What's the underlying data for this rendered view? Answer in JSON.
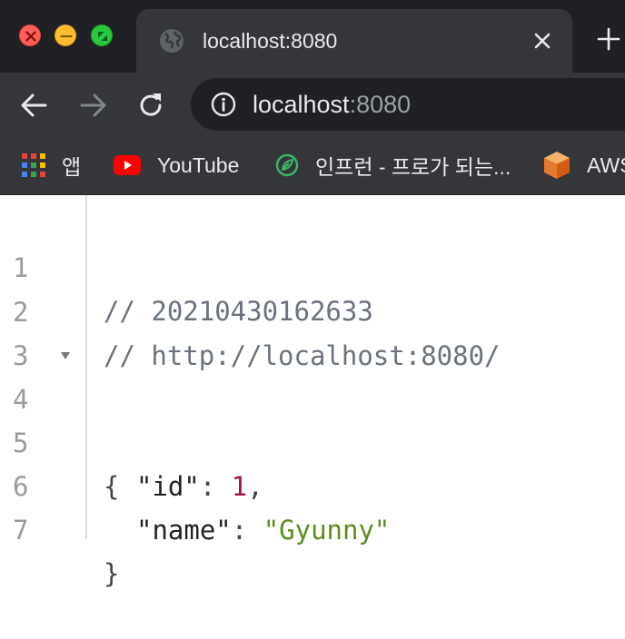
{
  "window": {
    "tab_title": "localhost:8080",
    "new_tab_symbol": "+"
  },
  "address_bar": {
    "host": "localhost",
    "port": ":8080"
  },
  "bookmarks": [
    {
      "label": "앱",
      "icon": "apps-grid-icon"
    },
    {
      "label": "YouTube",
      "icon": "youtube-icon"
    },
    {
      "label": "인프런 - 프로가 되는...",
      "icon": "inflearn-leaf-icon"
    },
    {
      "label": "AWS",
      "icon": "aws-cube-icon"
    }
  ],
  "json_view": {
    "lines": [
      {
        "number": "1",
        "comment": "// 20210430162633"
      },
      {
        "number": "2",
        "comment": "// http://localhost:8080/"
      },
      {
        "number": "3"
      },
      {
        "number": "4",
        "open_brace": "{"
      },
      {
        "number": "5",
        "key": "\"id\"",
        "colon": ":",
        "value": "1",
        "comma": ","
      },
      {
        "number": "6",
        "key": "\"name\"",
        "colon": ":",
        "value": "\"Gyunny\""
      },
      {
        "number": "7",
        "close_brace": "}"
      }
    ]
  },
  "colors": {
    "titlebar": "#202124",
    "toolbar": "#35363a",
    "comment": "#6a737d",
    "number": "#a0134b",
    "string": "#5a8f1c"
  }
}
